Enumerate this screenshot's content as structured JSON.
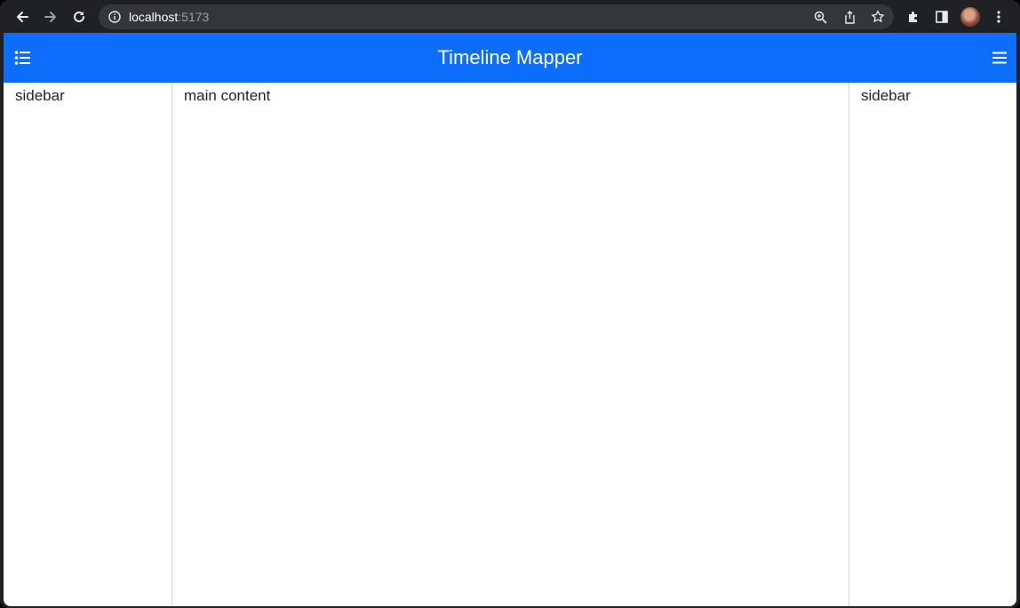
{
  "browser": {
    "url_host": "localhost",
    "url_port": ":5173",
    "icons": {
      "back": "back-arrow-icon",
      "forward": "forward-arrow-icon",
      "reload": "reload-icon",
      "info": "info-icon",
      "zoom": "zoom-icon",
      "share": "share-icon",
      "bookmark": "star-icon",
      "extensions": "puzzle-icon",
      "side_panel": "side-panel-icon",
      "menu": "kebab-menu-icon"
    }
  },
  "app": {
    "title": "Timeline Mapper",
    "accent_color": "#0d6efd",
    "left_toggle_icon": "list-icon",
    "right_toggle_icon": "hamburger-icon",
    "left_sidebar_text": "sidebar",
    "main_text": "main content",
    "right_sidebar_text": "sidebar"
  }
}
